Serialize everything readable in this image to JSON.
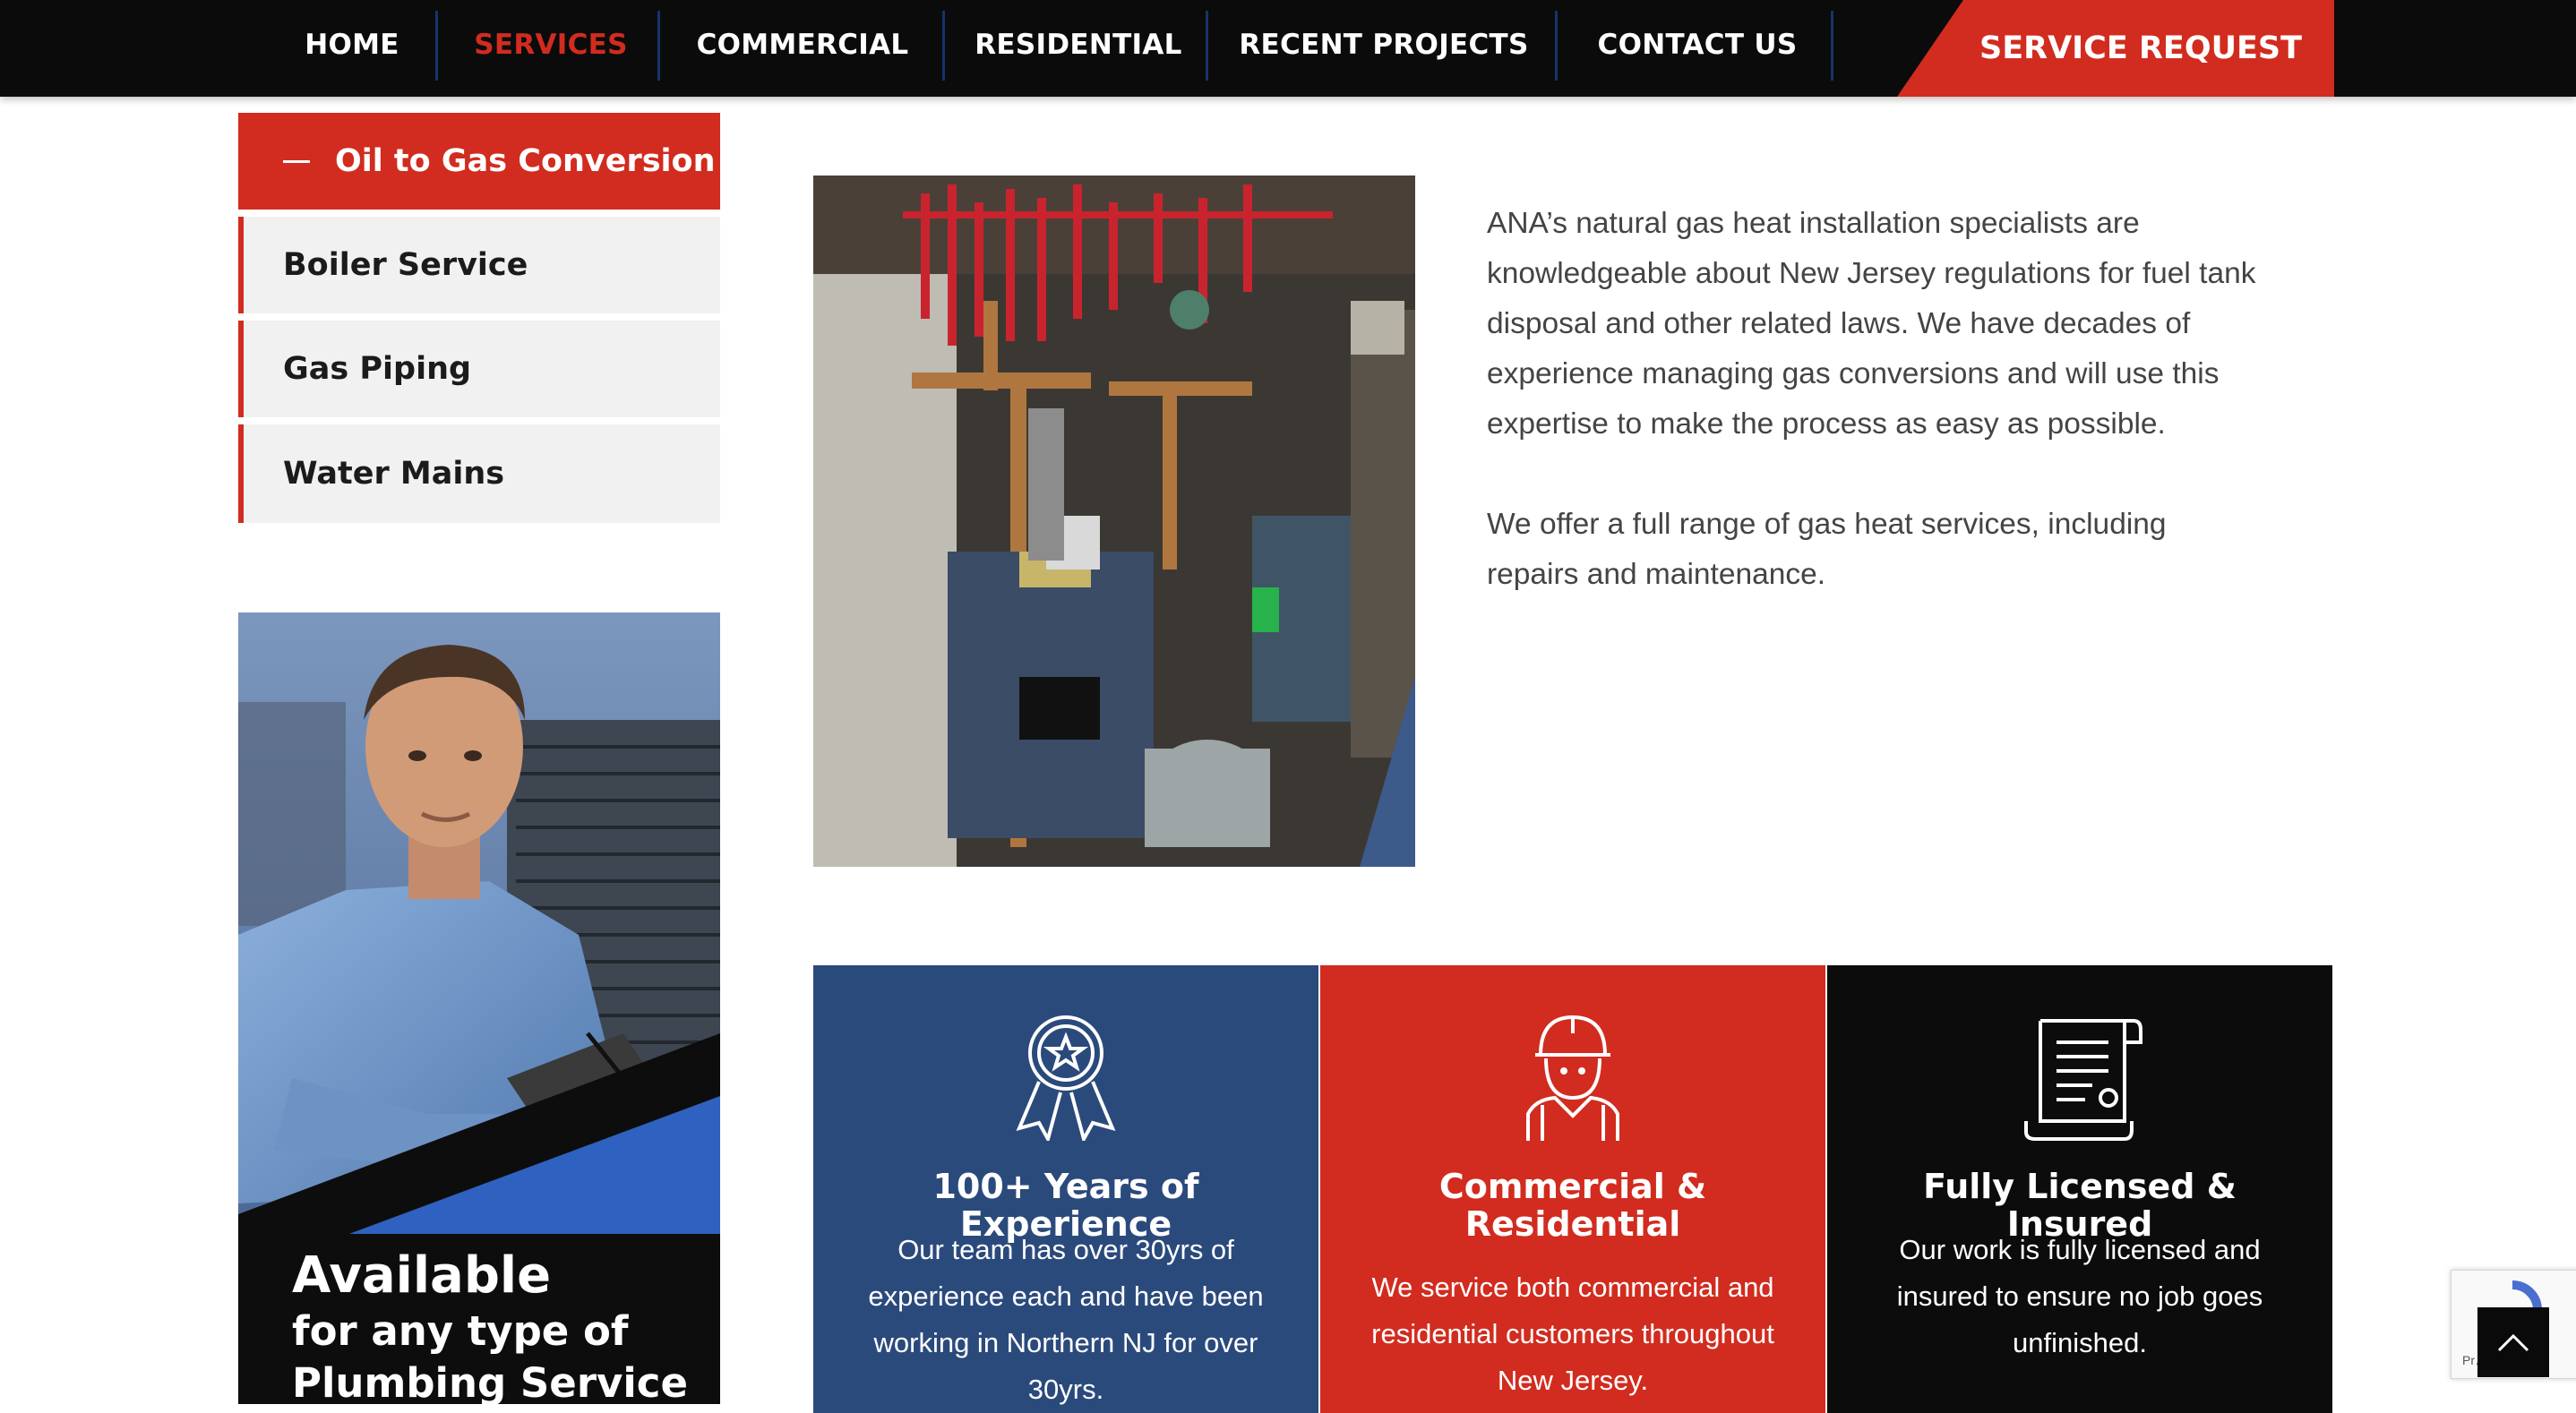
{
  "nav": {
    "items": [
      "HOME",
      "SERVICES",
      "COMMERCIAL",
      "RESIDENTIAL",
      "RECENT PROJECTS",
      "CONTACT US"
    ],
    "active": "SERVICES",
    "cta": "SERVICE REQUEST"
  },
  "sidebar": {
    "items": [
      {
        "label": "Oil to Gas Conversion",
        "active": true
      },
      {
        "label": "Boiler Service",
        "active": false
      },
      {
        "label": "Gas Piping",
        "active": false
      },
      {
        "label": "Water Mains",
        "active": false
      }
    ]
  },
  "promo": {
    "title": "Available",
    "subtitle_line1": "for any type of",
    "subtitle_line2": "Plumbing Service"
  },
  "content": {
    "paragraph1": "ANA’s natural gas heat installation specialists are knowledgeable about New Jersey regulations for fuel tank disposal and other related laws. We have decades of experience managing gas conversions and will use this expertise to make the process as easy as possible.",
    "paragraph2": "We offer a full range of gas heat services, including repairs and maintenance."
  },
  "features": [
    {
      "icon": "award-ribbon-icon",
      "title": "100+ Years of Experience",
      "text": "Our team has over 30yrs of experience each and have been working in Northern NJ for over 30yrs.",
      "bg": "#2b4a7c"
    },
    {
      "icon": "technician-icon",
      "title": "Commercial & Residential",
      "text": "We service both commercial and residential customers throughout New Jersey.",
      "bg": "#d12c1f"
    },
    {
      "icon": "license-scroll-icon",
      "title": "Fully Licensed & Insured",
      "text": "Our work is fully licensed and insured to ensure no job goes unfinished.",
      "bg": "#0c0c0c"
    }
  ],
  "widgets": {
    "recaptcha_text": "Pr… ms"
  },
  "colors": {
    "accent_red": "#d12c1f",
    "navy": "#2b4a7c",
    "black": "#0c0c0c",
    "menu_bg": "#f1f1f1"
  }
}
